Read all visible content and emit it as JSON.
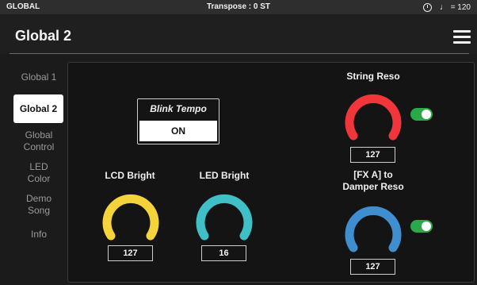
{
  "status_bar": {
    "mode": "GLOBAL",
    "transpose": "Transpose : 0 ST",
    "tempo": "= 120"
  },
  "header": {
    "title": "Global 2"
  },
  "sidebar": {
    "items": [
      {
        "label": "Global 1"
      },
      {
        "label": "Global 2"
      },
      {
        "label": "Global\nControl"
      },
      {
        "label": "LED\nColor"
      },
      {
        "label": "Demo\nSong"
      },
      {
        "label": "Info"
      }
    ]
  },
  "blink_tempo": {
    "label": "Blink Tempo",
    "value": "ON"
  },
  "knobs": {
    "lcd_bright": {
      "label": "LCD Bright",
      "value": "127",
      "color": "#f5d43b"
    },
    "led_bright": {
      "label": "LED Bright",
      "value": "16",
      "color": "#3fbfc6"
    },
    "string_reso": {
      "label": "String Reso",
      "value": "127",
      "color": "#f0353b"
    },
    "damper_reso": {
      "label": "[FX A] to\nDamper Reso",
      "value": "127",
      "color": "#3f8fd0"
    }
  },
  "toggles": {
    "color_on": "#2aa84a"
  }
}
